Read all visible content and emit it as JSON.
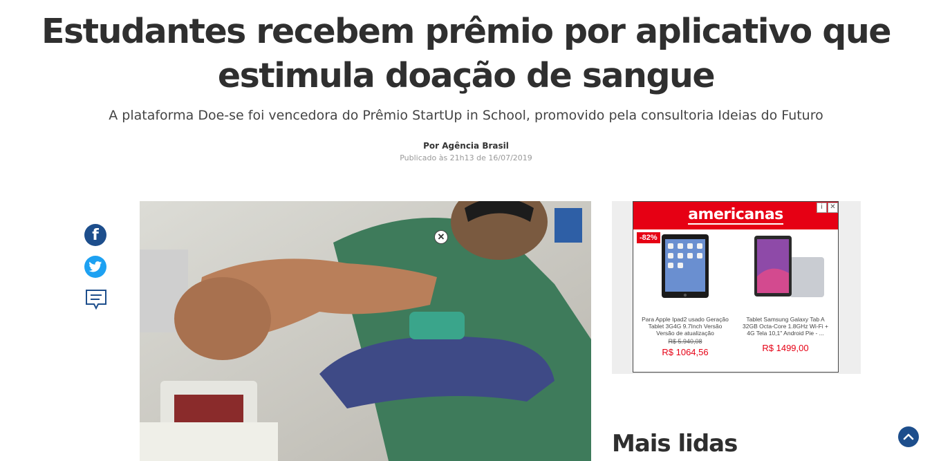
{
  "article": {
    "title": "Estudantes recebem prêmio por aplicativo que estimula doação de sangue",
    "subtitle": "A plataforma Doe-se foi vencedora do Prêmio StartUp in School, promovido pela consultoria Ideias do Futuro",
    "byline": "Por Agência Brasil",
    "published": "Publicado às 21h13 de 16/07/2019"
  },
  "share": {
    "facebook_glyph": "f",
    "icons": [
      "facebook-icon",
      "twitter-icon",
      "comment-icon"
    ]
  },
  "photo": {
    "close_glyph": "✕"
  },
  "ad": {
    "brand": "americanas",
    "brand_color": "#e60014",
    "info_glyph": "i",
    "close_glyph": "✕",
    "discount_badge": "-82%",
    "products": [
      {
        "name": "Para Apple Ipad2 usado Geração Tablet 3G4G 9.7Inch Versão Versão de atualização",
        "old_price": "R$ 5.940,08",
        "price": "R$ 1064,56"
      },
      {
        "name": "Tablet Samsung Galaxy Tab A 32GB Octa-Core 1.8GHz Wi-Fi + 4G Tela 10,1\" Android Pie - ...",
        "old_price": "",
        "price": "R$ 1499,00"
      }
    ]
  },
  "sidebar": {
    "most_read_title": "Mais lidas"
  },
  "colors": {
    "facebook": "#1d4e8c",
    "twitter": "#1da1f2",
    "back_to_top": "#1d4e8c"
  }
}
